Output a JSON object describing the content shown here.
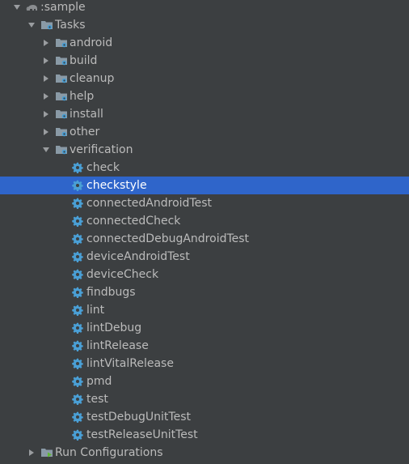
{
  "colors": {
    "background": "#3c3f41",
    "text": "#bbbbbb",
    "selection": "#2f65ca",
    "gear": "#4a9fd5",
    "folder": "#8a9aa6"
  },
  "tree": {
    "root": {
      "label": ":sample",
      "expanded": true,
      "icon": "elephant-icon"
    },
    "tasks": {
      "label": "Tasks",
      "expanded": true,
      "icon": "task-folder-icon"
    },
    "groups": [
      {
        "label": "android",
        "expanded": false
      },
      {
        "label": "build",
        "expanded": false
      },
      {
        "label": "cleanup",
        "expanded": false
      },
      {
        "label": "help",
        "expanded": false
      },
      {
        "label": "install",
        "expanded": false
      },
      {
        "label": "other",
        "expanded": false
      },
      {
        "label": "verification",
        "expanded": true
      }
    ],
    "verification_tasks": [
      {
        "label": "check",
        "selected": false
      },
      {
        "label": "checkstyle",
        "selected": true
      },
      {
        "label": "connectedAndroidTest",
        "selected": false
      },
      {
        "label": "connectedCheck",
        "selected": false
      },
      {
        "label": "connectedDebugAndroidTest",
        "selected": false
      },
      {
        "label": "deviceAndroidTest",
        "selected": false
      },
      {
        "label": "deviceCheck",
        "selected": false
      },
      {
        "label": "findbugs",
        "selected": false
      },
      {
        "label": "lint",
        "selected": false
      },
      {
        "label": "lintDebug",
        "selected": false
      },
      {
        "label": "lintRelease",
        "selected": false
      },
      {
        "label": "lintVitalRelease",
        "selected": false
      },
      {
        "label": "pmd",
        "selected": false
      },
      {
        "label": "test",
        "selected": false
      },
      {
        "label": "testDebugUnitTest",
        "selected": false
      },
      {
        "label": "testReleaseUnitTest",
        "selected": false
      }
    ],
    "run_configurations": {
      "label": "Run Configurations",
      "expanded": false,
      "icon": "run-config-icon"
    }
  }
}
